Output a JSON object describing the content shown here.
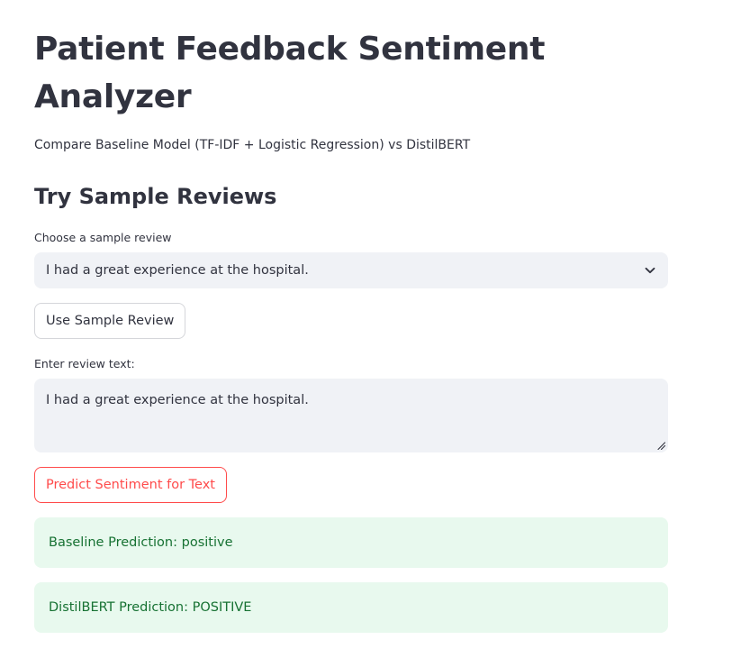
{
  "page": {
    "title": "Patient Feedback Sentiment Analyzer",
    "subtitle": "Compare Baseline Model (TF-IDF + Logistic Regression) vs DistilBERT"
  },
  "samples": {
    "heading": "Try Sample Reviews",
    "select_label": "Choose a sample review",
    "selected_value": "I had a great experience at the hospital.",
    "select_icon": "chevron-down-icon",
    "use_button_label": "Use Sample Review"
  },
  "review_input": {
    "label": "Enter review text:",
    "value": "I had a great experience at the hospital."
  },
  "predict": {
    "button_label": "Predict Sentiment for Text",
    "accent_color": "#ff4b4b"
  },
  "results": {
    "baseline": "Baseline Prediction: positive",
    "distilbert": "DistilBERT Prediction: POSITIVE",
    "success_bg_color": "#e8f9ee",
    "success_text_color": "#177233"
  }
}
